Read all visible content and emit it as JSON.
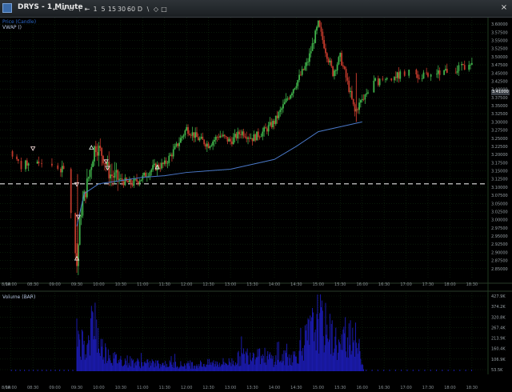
{
  "window": {
    "title": "DRYS - 1 Minute",
    "close_glyph": "×",
    "toolbar": [
      "←",
      "→",
      "⇔",
      "\\",
      "⇤",
      "1",
      "5",
      "15",
      "30",
      "60",
      "D",
      "\\",
      "◇",
      "□"
    ]
  },
  "legend": {
    "price_label": "Price (Candle)",
    "vwap_label": "VWAP ()",
    "volume_label": "Volume (BAR)"
  },
  "colors": {
    "background": "#000000",
    "up_candle": "#3fb24a",
    "down_candle": "#c0392b",
    "vwap": "#4a78c8",
    "volume": "#1a1aa8",
    "grid": "#0e2a0e",
    "reference_line": "#e6e6e6",
    "price_label_color": "#2a66c9",
    "vwap_label_color": "#b9c8e6"
  },
  "price_axis": {
    "ticks": [
      "3.60000",
      "3.57500",
      "3.55000",
      "3.52500",
      "3.50000",
      "3.47500",
      "3.45000",
      "3.42500",
      "3.40000",
      "3.37500",
      "3.35000",
      "3.32500",
      "3.30000",
      "3.27500",
      "3.25000",
      "3.22500",
      "3.20000",
      "3.17500",
      "3.15000",
      "3.12500",
      "3.10000",
      "3.07500",
      "3.05000",
      "3.02500",
      "3.00000",
      "2.97500",
      "2.95000",
      "2.92500",
      "2.90000",
      "2.87500",
      "2.85000"
    ],
    "current_price": "3.41000"
  },
  "volume_axis": {
    "ticks": [
      "427.9K",
      "374.2K",
      "320.8K",
      "267.4K",
      "213.9K",
      "160.4K",
      "106.9K",
      "53.5K"
    ]
  },
  "time_axis": {
    "date_label": "8/14",
    "ticks": [
      "08:00",
      "08:30",
      "09:00",
      "09:30",
      "10:00",
      "10:30",
      "11:00",
      "11:30",
      "12:00",
      "12:30",
      "13:00",
      "13:30",
      "14:00",
      "14:30",
      "15:00",
      "15:30",
      "16:00",
      "16:30",
      "17:00",
      "17:30",
      "18:00",
      "18:30"
    ]
  },
  "chart_data": {
    "type": "candlestick",
    "series": [
      {
        "name": "Price (Candle)"
      },
      {
        "name": "VWAP ()"
      },
      {
        "name": "Volume (BAR)"
      }
    ],
    "reference_line_price": 3.11,
    "ylim": [
      2.82,
      3.62
    ],
    "vwap_points": [
      {
        "t": "09:30",
        "v": 2.98
      },
      {
        "t": "09:40",
        "v": 3.08
      },
      {
        "t": "10:00",
        "v": 3.11
      },
      {
        "t": "10:30",
        "v": 3.12
      },
      {
        "t": "11:00",
        "v": 3.13
      },
      {
        "t": "11:30",
        "v": 3.135
      },
      {
        "t": "12:00",
        "v": 3.145
      },
      {
        "t": "12:30",
        "v": 3.15
      },
      {
        "t": "13:00",
        "v": 3.155
      },
      {
        "t": "13:30",
        "v": 3.17
      },
      {
        "t": "14:00",
        "v": 3.185
      },
      {
        "t": "14:30",
        "v": 3.225
      },
      {
        "t": "15:00",
        "v": 3.27
      },
      {
        "t": "15:30",
        "v": 3.285
      },
      {
        "t": "16:00",
        "v": 3.3
      }
    ],
    "candle_path": [
      {
        "t": "08:00",
        "v": 3.21
      },
      {
        "t": "08:15",
        "v": 3.16
      },
      {
        "t": "08:30",
        "v": 3.19
      },
      {
        "t": "08:45",
        "v": 3.17
      },
      {
        "t": "09:00",
        "v": 3.16
      },
      {
        "t": "09:15",
        "v": 3.15
      },
      {
        "t": "09:30",
        "v": 2.86
      },
      {
        "t": "09:35",
        "v": 3.02
      },
      {
        "t": "09:45",
        "v": 3.12
      },
      {
        "t": "09:55",
        "v": 3.23
      },
      {
        "t": "10:05",
        "v": 3.2
      },
      {
        "t": "10:15",
        "v": 3.14
      },
      {
        "t": "10:30",
        "v": 3.12
      },
      {
        "t": "10:45",
        "v": 3.11
      },
      {
        "t": "11:00",
        "v": 3.13
      },
      {
        "t": "11:15",
        "v": 3.16
      },
      {
        "t": "11:30",
        "v": 3.17
      },
      {
        "t": "11:45",
        "v": 3.22
      },
      {
        "t": "12:00",
        "v": 3.28
      },
      {
        "t": "12:15",
        "v": 3.25
      },
      {
        "t": "12:30",
        "v": 3.23
      },
      {
        "t": "12:45",
        "v": 3.26
      },
      {
        "t": "13:00",
        "v": 3.24
      },
      {
        "t": "13:15",
        "v": 3.27
      },
      {
        "t": "13:30",
        "v": 3.25
      },
      {
        "t": "13:45",
        "v": 3.27
      },
      {
        "t": "14:00",
        "v": 3.3
      },
      {
        "t": "14:15",
        "v": 3.36
      },
      {
        "t": "14:30",
        "v": 3.42
      },
      {
        "t": "14:45",
        "v": 3.48
      },
      {
        "t": "15:00",
        "v": 3.6
      },
      {
        "t": "15:10",
        "v": 3.52
      },
      {
        "t": "15:20",
        "v": 3.45
      },
      {
        "t": "15:30",
        "v": 3.5
      },
      {
        "t": "15:40",
        "v": 3.42
      },
      {
        "t": "15:50",
        "v": 3.33
      },
      {
        "t": "16:00",
        "v": 3.37
      },
      {
        "t": "16:15",
        "v": 3.42
      },
      {
        "t": "16:30",
        "v": 3.43
      },
      {
        "t": "17:00",
        "v": 3.45
      },
      {
        "t": "17:30",
        "v": 3.44
      },
      {
        "t": "18:00",
        "v": 3.46
      },
      {
        "t": "18:30",
        "v": 3.47
      }
    ],
    "markers": [
      {
        "t": "08:30",
        "v": 3.22,
        "kind": "sell"
      },
      {
        "t": "09:30",
        "v": 3.11,
        "kind": "sell"
      },
      {
        "t": "09:32",
        "v": 3.01,
        "kind": "sell"
      },
      {
        "t": "09:30",
        "v": 2.88,
        "kind": "buy"
      },
      {
        "t": "09:50",
        "v": 3.22,
        "kind": "buy"
      },
      {
        "t": "10:10",
        "v": 3.18,
        "kind": "sell"
      },
      {
        "t": "10:12",
        "v": 3.16,
        "kind": "sell"
      },
      {
        "t": "11:20",
        "v": 3.16,
        "kind": "buy"
      }
    ],
    "volume_profile": [
      {
        "t": "09:30",
        "v": 320
      },
      {
        "t": "09:35",
        "v": 250
      },
      {
        "t": "09:45",
        "v": 180
      },
      {
        "t": "09:55",
        "v": 428
      },
      {
        "t": "10:00",
        "v": 210
      },
      {
        "t": "10:10",
        "v": 150
      },
      {
        "t": "10:20",
        "v": 100
      },
      {
        "t": "11:00",
        "v": 60
      },
      {
        "t": "12:00",
        "v": 50
      },
      {
        "t": "13:00",
        "v": 70
      },
      {
        "t": "13:30",
        "v": 150
      },
      {
        "t": "14:00",
        "v": 90
      },
      {
        "t": "14:30",
        "v": 120
      },
      {
        "t": "15:00",
        "v": 400
      },
      {
        "t": "15:15",
        "v": 300
      },
      {
        "t": "15:30",
        "v": 180
      },
      {
        "t": "15:45",
        "v": 330
      },
      {
        "t": "16:00",
        "v": 100
      }
    ]
  }
}
